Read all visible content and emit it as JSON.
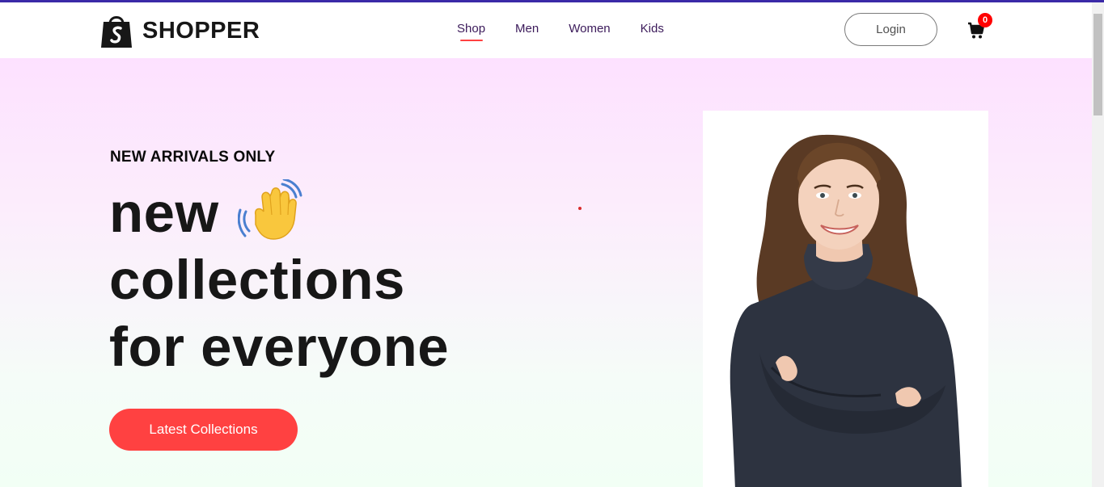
{
  "brand": {
    "name": "SHOPPER",
    "logo_icon": "shopping-bag-icon"
  },
  "nav": {
    "items": [
      {
        "label": "Shop",
        "active": true
      },
      {
        "label": "Men",
        "active": false
      },
      {
        "label": "Women",
        "active": false
      },
      {
        "label": "Kids",
        "active": false
      }
    ]
  },
  "header": {
    "login_label": "Login",
    "cart_icon": "cart-icon",
    "cart_count": "0"
  },
  "hero": {
    "tagline": "NEW ARRIVALS ONLY",
    "headline_1": "new",
    "headline_2": "collections",
    "headline_3": "for everyone",
    "hand_icon": "waving-hand-icon",
    "cta_label": "Latest Collections",
    "image_icon": "model-photo"
  },
  "colors": {
    "accent": "#ff4141",
    "nav_text": "#3b1a5a",
    "top_border": "#3b2aa8",
    "hero_gradient_top": "#fde1ff",
    "hero_gradient_bottom": "#f2fff5"
  }
}
